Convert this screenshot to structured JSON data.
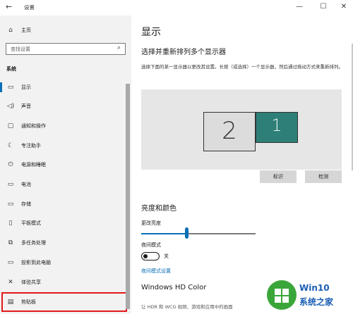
{
  "window": {
    "title": "设置",
    "back_glyph": "←",
    "minimize_glyph": "—",
    "maximize_glyph": "☐",
    "close_glyph": "✕"
  },
  "sidebar": {
    "home_label": "主页",
    "search_placeholder": "查找设置",
    "section_title": "系统",
    "items": [
      {
        "label": "显示",
        "icon": "monitor-icon",
        "glyph": "▭"
      },
      {
        "label": "声音",
        "icon": "speaker-icon",
        "glyph": "◁)"
      },
      {
        "label": "通知和操作",
        "icon": "notification-icon",
        "glyph": "▢"
      },
      {
        "label": "专注助手",
        "icon": "moon-icon",
        "glyph": "☾"
      },
      {
        "label": "电源和睡眠",
        "icon": "power-icon",
        "glyph": "⏻"
      },
      {
        "label": "电池",
        "icon": "battery-icon",
        "glyph": "▭"
      },
      {
        "label": "存储",
        "icon": "storage-icon",
        "glyph": "▭"
      },
      {
        "label": "平板模式",
        "icon": "tablet-icon",
        "glyph": "▯"
      },
      {
        "label": "多任务处理",
        "icon": "multitask-icon",
        "glyph": "⧉"
      },
      {
        "label": "投影到此电脑",
        "icon": "project-icon",
        "glyph": "▭"
      },
      {
        "label": "体验共享",
        "icon": "share-icon",
        "glyph": "✕"
      },
      {
        "label": "剪贴板",
        "icon": "clipboard-icon",
        "glyph": "▤"
      }
    ]
  },
  "main": {
    "page_title": "显示",
    "arrange_title": "选择并重新排列多个显示器",
    "arrange_desc": "选择下面的某一显示器以更改其设置。长按（或选择）一个显示器，然后通过拖动方式来重新排列。",
    "monitors": [
      "2",
      "1"
    ],
    "identify_button": "标识",
    "detect_button": "检测",
    "brightness_title": "亮度和颜色",
    "brightness_label": "更改亮度",
    "brightness_level": 0.4,
    "night_mode_label": "夜间模式",
    "night_mode_state": "关",
    "night_mode_link": "夜间模式设置",
    "hdr_title": "Windows HD Color",
    "hdr_desc": "让 HDR 和 WCG 视频、游戏和应用中的画面"
  },
  "watermark": {
    "line1": "Win10",
    "line2": "系统之家"
  },
  "colors": {
    "accent": "#0a6fb6",
    "monitor_selected": "#2e7f77",
    "highlight_box": "#e21a1a"
  }
}
